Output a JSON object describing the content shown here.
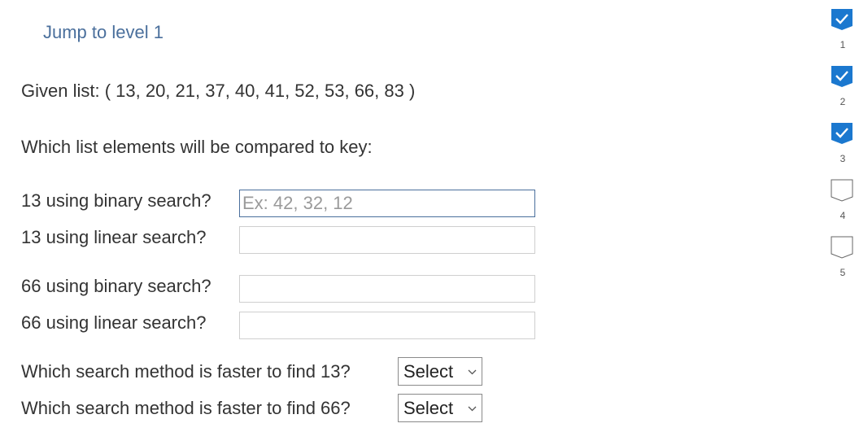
{
  "jump_link": "Jump to level 1",
  "given_list": "Given list: ( 13, 20, 21, 37, 40, 41, 52, 53, 66, 83 )",
  "question_heading": "Which list elements will be compared to key:",
  "questions": [
    {
      "label": "13 using binary search?",
      "placeholder": "Ex: 42, 32, 12",
      "value": ""
    },
    {
      "label": "13 using linear search?",
      "placeholder": "",
      "value": ""
    },
    {
      "label": "66 using binary search?",
      "placeholder": "",
      "value": ""
    },
    {
      "label": "66 using linear search?",
      "placeholder": "",
      "value": ""
    }
  ],
  "selects": [
    {
      "label": "Which search method is faster to find 13?",
      "value": "Select"
    },
    {
      "label": "Which search method is faster to find 66?",
      "value": "Select"
    }
  ],
  "levels": [
    {
      "number": "1",
      "status": "completed",
      "icon": "check-icon"
    },
    {
      "number": "2",
      "status": "completed",
      "icon": "check-icon"
    },
    {
      "number": "3",
      "status": "completed",
      "icon": "check-icon"
    },
    {
      "number": "4",
      "status": "incomplete",
      "icon": "empty-badge-icon"
    },
    {
      "number": "5",
      "status": "incomplete",
      "icon": "empty-badge-icon"
    }
  ],
  "colors": {
    "accent": "#1b78cf",
    "link": "#4a6f9c",
    "text": "#333333"
  }
}
